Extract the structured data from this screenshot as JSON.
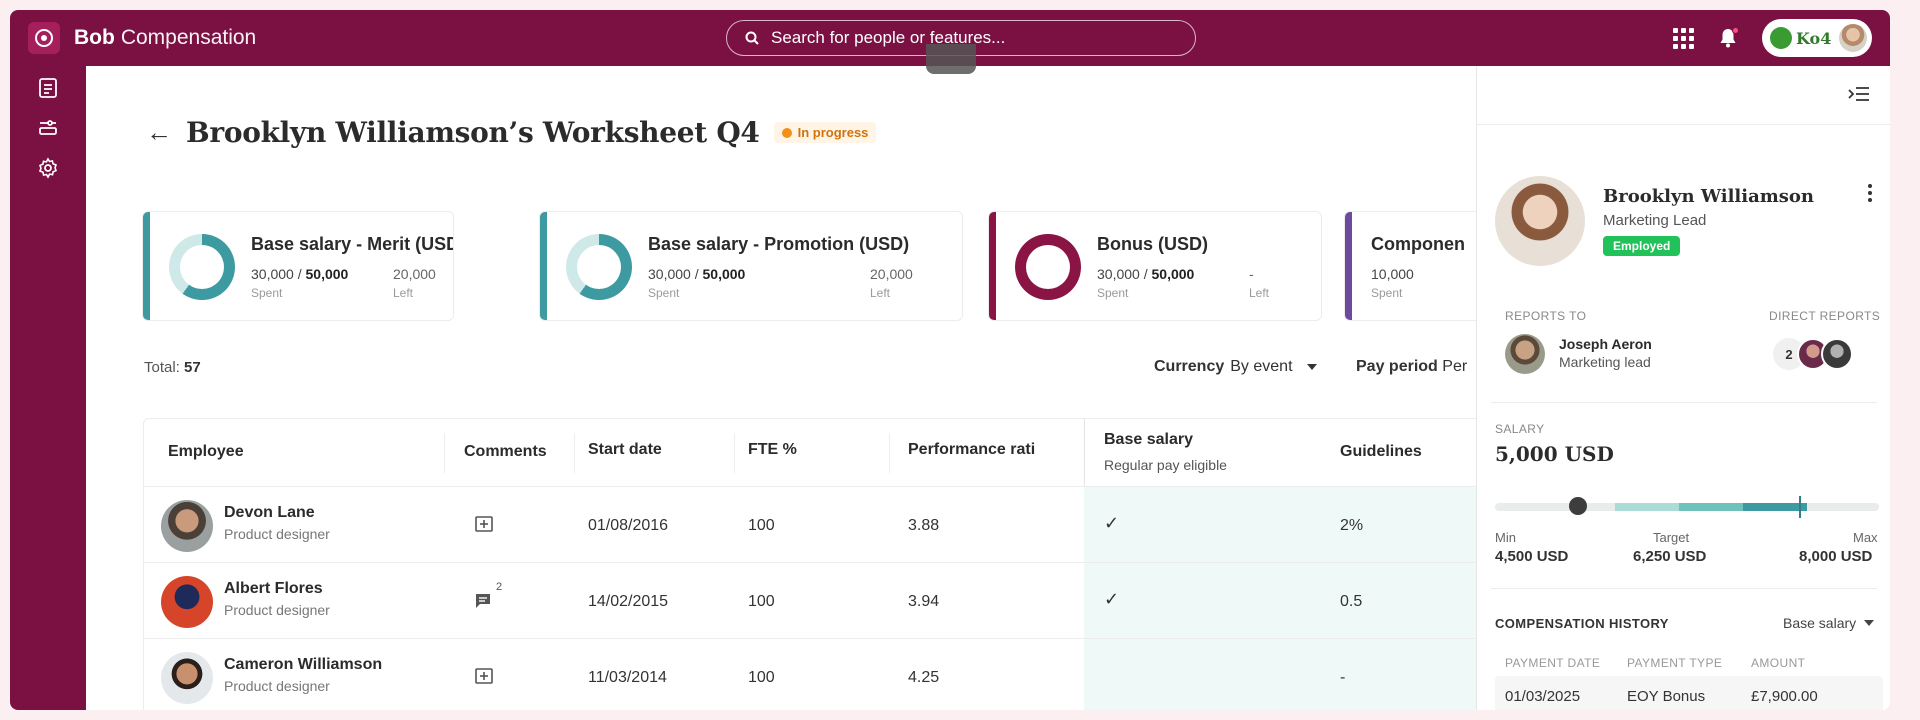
{
  "app": {
    "brand_bold": "Bob",
    "brand_light": "Compensation",
    "search_placeholder": "Search for people or features...",
    "company": "Ko4"
  },
  "page": {
    "title": "Brooklyn Williamson’s Worksheet Q4",
    "status": "In progress",
    "status_color": "#f39019"
  },
  "budget_cards": [
    {
      "title": "Base salary - Merit (USD)",
      "spent": "30,000",
      "total": "50,000",
      "left": "20,000",
      "spent_label": "Spent",
      "left_label": "Left",
      "accent": "#3d9aa0",
      "fill_fraction": 0.6
    },
    {
      "title": "Base salary - Promotion (USD)",
      "spent": "30,000",
      "total": "50,000",
      "left": "20,000",
      "spent_label": "Spent",
      "left_label": "Left",
      "accent": "#3d9aa0",
      "fill_fraction": 0.6
    },
    {
      "title": "Bonus (USD)",
      "spent": "30,000",
      "total": "50,000",
      "left": "-",
      "spent_label": "Spent",
      "left_label": "Left",
      "accent": "#8a1545",
      "fill_fraction": 1.0
    },
    {
      "title": "Componen",
      "spent": "10,000",
      "spent_label": "Spent",
      "accent": "#6d4a9e"
    }
  ],
  "toolbar": {
    "total_label": "Total:",
    "total_value": "57",
    "currency_label": "Currency",
    "currency_value": "By event",
    "pay_period_label": "Pay period",
    "pay_period_value": "Per"
  },
  "table": {
    "headers": {
      "employee": "Employee",
      "comments": "Comments",
      "start_date": "Start date",
      "fte": "FTE %",
      "performance": "Performance rati",
      "base_salary": "Base salary",
      "base_salary_sub": "Regular pay eligible",
      "guidelines": "Guidelines"
    },
    "rows": [
      {
        "name": "Devon Lane",
        "role": "Product designer",
        "comment_count": "",
        "start_date": "01/08/2016",
        "fte": "100",
        "performance": "3.88",
        "base_salary_check": "✓",
        "guidelines": "2%"
      },
      {
        "name": "Albert Flores",
        "role": "Product designer",
        "comment_count": "2",
        "start_date": "14/02/2015",
        "fte": "100",
        "performance": "3.94",
        "base_salary_check": "✓",
        "guidelines": "0.5"
      },
      {
        "name": "Cameron Williamson",
        "role": "Product designer",
        "comment_count": "",
        "start_date": "11/03/2014",
        "fte": "100",
        "performance": "4.25",
        "base_salary_check": "",
        "guidelines": "-"
      }
    ]
  },
  "panel": {
    "name": "Brooklyn Williamson",
    "role": "Marketing Lead",
    "badge": "Employed",
    "reports_to_label": "REPORTS TO",
    "direct_reports_label": "DIRECT REPORTS",
    "manager_name": "Joseph Aeron",
    "manager_role": "Marketing lead",
    "direct_reports_count": "2",
    "salary_label": "SALARY",
    "salary_value": "5,000 USD",
    "range": {
      "min_label": "Min",
      "min_value": "4,500 USD",
      "target_label": "Target",
      "target_value": "6,250 USD",
      "max_label": "Max",
      "max_value": "8,000 USD"
    },
    "history_title": "COMPENSATION HISTORY",
    "history_filter": "Base salary",
    "history_headers": {
      "date": "PAYMENT DATE",
      "type": "PAYMENT TYPE",
      "amount": "AMOUNT"
    },
    "history_rows": [
      {
        "date": "01/03/2025",
        "type": "EOY Bonus",
        "amount": "£7,900.00"
      }
    ]
  }
}
